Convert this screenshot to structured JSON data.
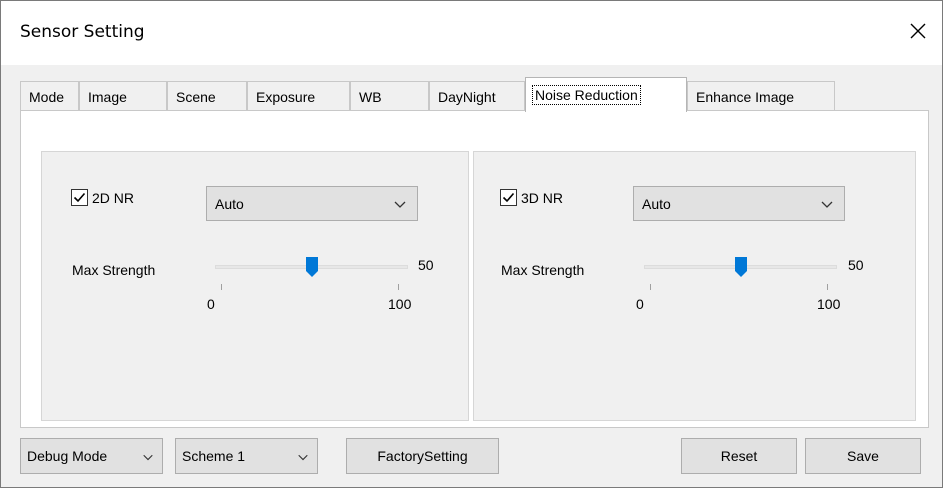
{
  "window": {
    "title": "Sensor Setting"
  },
  "tabs": [
    {
      "label": "Mode"
    },
    {
      "label": "Image"
    },
    {
      "label": "Scene"
    },
    {
      "label": "Exposure"
    },
    {
      "label": "WB"
    },
    {
      "label": "DayNight"
    },
    {
      "label": "Noise Reduction",
      "active": true
    },
    {
      "label": "Enhance Image"
    }
  ],
  "nr2d": {
    "checkbox_label": "2D NR",
    "checked": true,
    "mode_value": "Auto",
    "strength_label": "Max Strength",
    "strength_value": "50",
    "min_label": "0",
    "max_label": "100",
    "level_fraction": 0.5
  },
  "nr3d": {
    "checkbox_label": "3D NR",
    "checked": true,
    "mode_value": "Auto",
    "strength_label": "Max Strength",
    "strength_value": "50",
    "min_label": "0",
    "max_label": "100",
    "level_fraction": 0.5
  },
  "footer": {
    "debug_mode": "Debug Mode",
    "scheme": "Scheme 1",
    "factory_label": "FactorySetting",
    "reset_label": "Reset",
    "save_label": "Save"
  },
  "colors": {
    "slider_thumb": "#0078d7"
  }
}
